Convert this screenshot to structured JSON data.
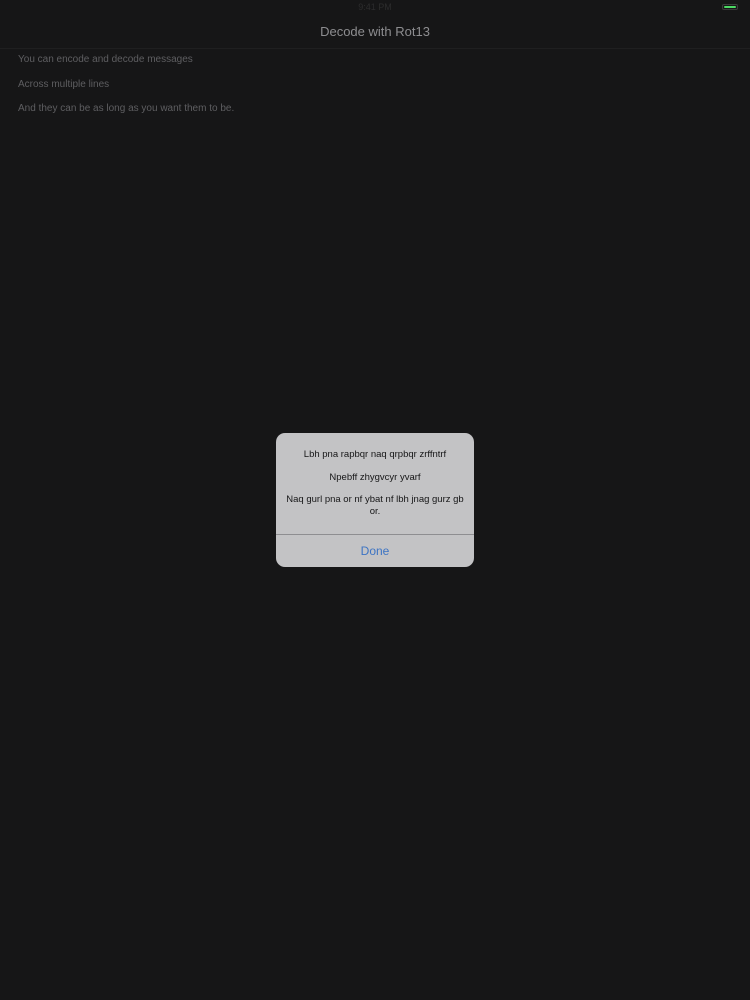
{
  "status_bar": {
    "time": "9:41 PM",
    "battery_color": "#4cd964"
  },
  "nav": {
    "title": "Decode with Rot13"
  },
  "content": {
    "lines": [
      "You can encode and decode messages",
      "Across multiple lines",
      "And they can be as long as you want them to be."
    ]
  },
  "alert": {
    "messages": [
      "Lbh pna rapbqr naq qrpbqr zrffntrf",
      "Npebff zhygvcyr yvarf",
      "Naq gurl pna or nf ybat nf lbh jnag gurz gb or."
    ],
    "button_label": "Done",
    "button_color": "#3d74c4"
  }
}
